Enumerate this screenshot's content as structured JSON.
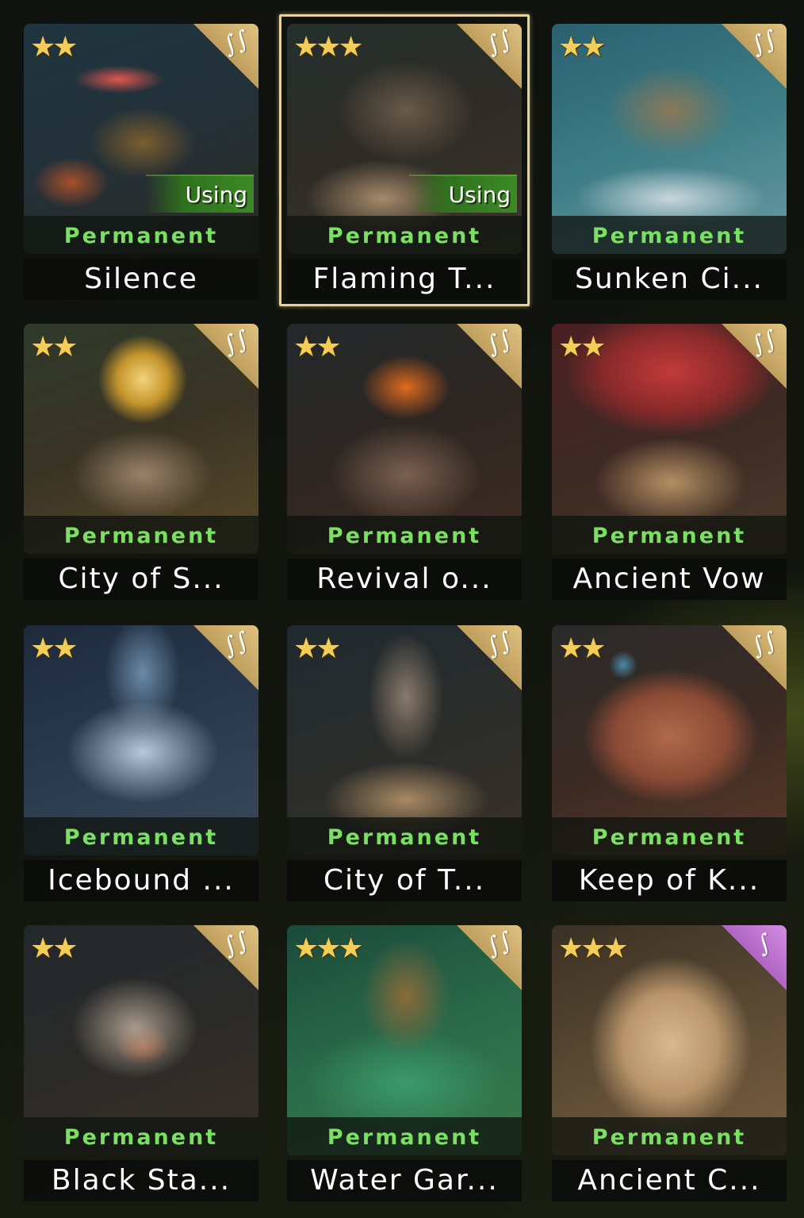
{
  "colors": {
    "permanent_text": "#79e061",
    "star_gold": "#f2cd57",
    "using_badge": "#3c8a26",
    "selected_border": "#e7d39a",
    "rarity_gold": "#c9a865",
    "rarity_purple": "#b86ccd"
  },
  "icons": {
    "star": "★",
    "corner_emblem": "∫∫",
    "corner_emblem_single": "∫"
  },
  "cards": [
    {
      "name": "Silence",
      "stars": "★★",
      "status": "Permanent",
      "badge": "Using",
      "rarity": "gold",
      "emblem": "∫∫",
      "selected": false
    },
    {
      "name": "Flaming T...",
      "stars": "★★★",
      "status": "Permanent",
      "badge": "Using",
      "rarity": "gold",
      "emblem": "∫∫",
      "selected": true
    },
    {
      "name": "Sunken Ci...",
      "stars": "★★",
      "status": "Permanent",
      "badge": "",
      "rarity": "gold",
      "emblem": "∫∫",
      "selected": false
    },
    {
      "name": "City of S...",
      "stars": "★★",
      "status": "Permanent",
      "badge": "",
      "rarity": "gold",
      "emblem": "∫∫",
      "selected": false
    },
    {
      "name": "Revival o...",
      "stars": "★★",
      "status": "Permanent",
      "badge": "",
      "rarity": "gold",
      "emblem": "∫∫",
      "selected": false
    },
    {
      "name": "Ancient Vow",
      "stars": "★★",
      "status": "Permanent",
      "badge": "",
      "rarity": "gold",
      "emblem": "∫∫",
      "selected": false
    },
    {
      "name": "Icebound ...",
      "stars": "★★",
      "status": "Permanent",
      "badge": "",
      "rarity": "gold",
      "emblem": "∫∫",
      "selected": false
    },
    {
      "name": "City of T...",
      "stars": "★★",
      "status": "Permanent",
      "badge": "",
      "rarity": "gold",
      "emblem": "∫∫",
      "selected": false
    },
    {
      "name": "Keep of K...",
      "stars": "★★",
      "status": "Permanent",
      "badge": "",
      "rarity": "gold",
      "emblem": "∫∫",
      "selected": false
    },
    {
      "name": "Black Sta...",
      "stars": "★★",
      "status": "Permanent",
      "badge": "",
      "rarity": "gold",
      "emblem": "∫∫",
      "selected": false
    },
    {
      "name": "Water Gar...",
      "stars": "★★★",
      "status": "Permanent",
      "badge": "",
      "rarity": "gold",
      "emblem": "∫∫",
      "selected": false
    },
    {
      "name": "Ancient C...",
      "stars": "★★★",
      "status": "Permanent",
      "badge": "",
      "rarity": "purple",
      "emblem": "∫",
      "selected": false
    }
  ]
}
